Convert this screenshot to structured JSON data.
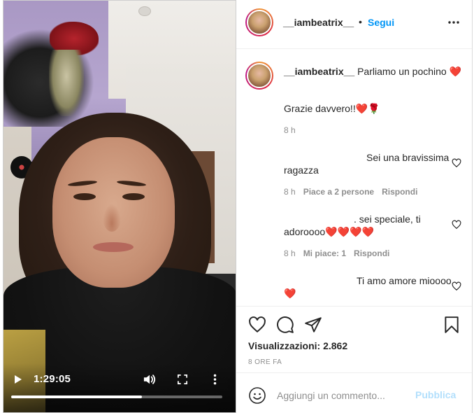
{
  "video": {
    "time": "1:29:05",
    "progress_fraction": 0.62
  },
  "header": {
    "username": "__iambeatrix__",
    "separator": "•",
    "follow_label": "Segui"
  },
  "caption": {
    "username": "__iambeatrix__",
    "text": "Parliamo un pochino ❤️",
    "line2": "Grazie davvero!!❤️🌹",
    "time": "8 h"
  },
  "comments": [
    {
      "text": "Sei una bravissima ragazza",
      "time": "8 h",
      "likes": "Piace a 2 persone",
      "reply": "Rispondi"
    },
    {
      "text": ". sei speciale, ti adoroooo❤️❤️❤️❤️",
      "time": "8 h",
      "likes": "Mi piace: 1",
      "reply": "Rispondi"
    },
    {
      "text": "Ti amo amore mioooo❤️"
    }
  ],
  "stats": {
    "views": "Visualizzazioni: 2.862",
    "ago": "8 ORE FA"
  },
  "composer": {
    "placeholder": "Aggiungi un commento...",
    "publish_label": "Pubblica"
  },
  "colors": {
    "link_blue": "#0095f6",
    "publish_disabled": "#b2dffc",
    "muted": "#8e8e8e"
  },
  "icons": {
    "play": "play-icon",
    "volume": "volume-icon",
    "fullscreen": "fullscreen-icon",
    "more": "more-vertical-icon",
    "options": "more-horizontal-icon",
    "like": "heart-icon",
    "comment": "comment-icon",
    "share": "send-icon",
    "save": "bookmark-icon",
    "emoji": "emoji-icon"
  }
}
